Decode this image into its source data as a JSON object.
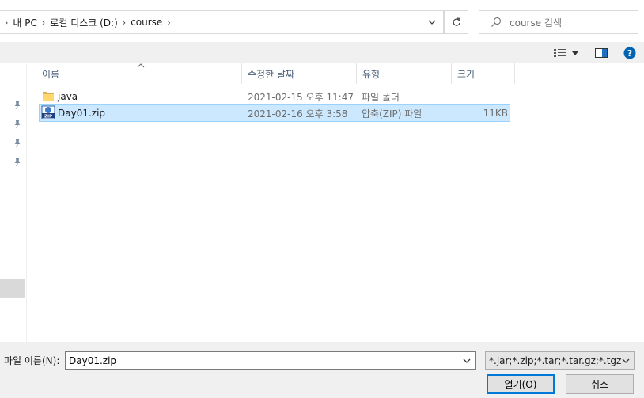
{
  "address_bar": {
    "crumbs": [
      "내 PC",
      "로컬 디스크 (D:)",
      "course"
    ],
    "separator": "›"
  },
  "search": {
    "placeholder": "course 검색"
  },
  "columns": {
    "name": "이름",
    "date": "수정한 날짜",
    "type": "유형",
    "size": "크기"
  },
  "files": [
    {
      "name": "java",
      "date": "2021-02-15 오후 11:47",
      "type": "파일 폴더",
      "size": "",
      "icon": "folder-icon",
      "selected": false
    },
    {
      "name": "Day01.zip",
      "date": "2021-02-16 오후 3:58",
      "type": "압축(ZIP) 파일",
      "size": "11KB",
      "icon": "zip-file-icon",
      "selected": true
    }
  ],
  "bottom": {
    "filename_label": "파일 이름(N):",
    "filename_value": "Day01.zip",
    "filter_value": "*.jar;*.zip;*.tar;*.tar.gz;*.tgz",
    "open_label": "열기(O)",
    "cancel_label": "취소"
  },
  "colors": {
    "accent": "#0078d7",
    "selection": "#cce8ff",
    "selection_border": "#99d1ff",
    "help": "#0063b1"
  }
}
